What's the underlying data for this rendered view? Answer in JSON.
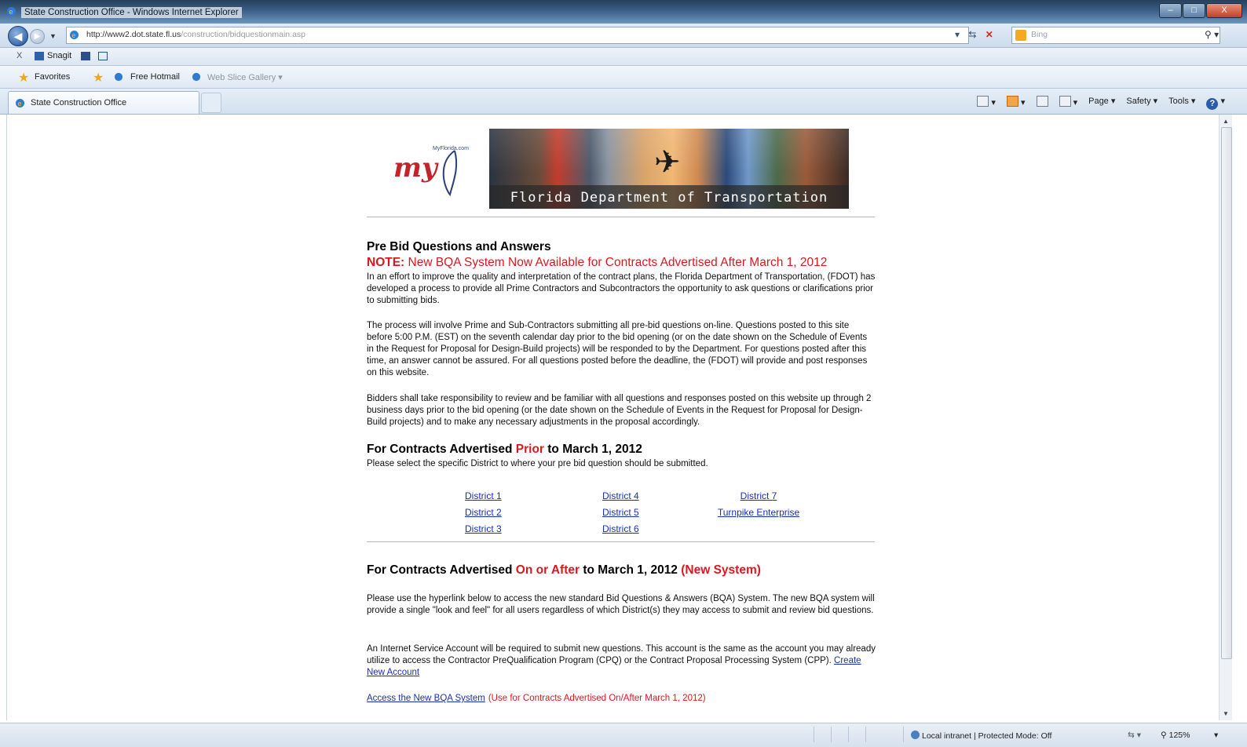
{
  "window": {
    "title": "State Construction Office - Windows Internet Explorer",
    "controls": {
      "minimize": "–",
      "maximize": "□",
      "close": "X"
    }
  },
  "address_bar": {
    "url_host": "http://www2.dot.state.fl.us",
    "url_path": "/construction/bidquestionmain.asp",
    "search_placeholder": "Bing"
  },
  "links_bar": {
    "close": "X",
    "snagit": "Snagit"
  },
  "favorites_bar": {
    "favorites": "Favorites",
    "free_hotmail": "Free Hotmail",
    "web_slice_gallery": "Web Slice Gallery ▾"
  },
  "tab": {
    "title": "State Construction Office"
  },
  "command_bar": {
    "page": "Page ▾",
    "safety": "Safety ▾",
    "tools": "Tools ▾",
    "help": "?"
  },
  "banner": {
    "logo_text": "my",
    "logo_small": "MyFlorida.com",
    "photo_caption": "Florida Department of Transportation"
  },
  "page": {
    "heading": "Pre Bid Questions and Answers",
    "note_label": "NOTE:",
    "note_text": "New BQA System Now Available for Contracts Advertised After March 1, 2012",
    "para1": "In an effort to improve the quality and interpretation of the contract plans, the Florida Department of Transportation, (FDOT) has developed a process to provide all Prime Contractors and Subcontractors the opportunity to ask questions or clarifications prior to submitting bids.",
    "para2": "The process will involve Prime and Sub-Contractors submitting all pre-bid questions on-line. Questions posted to this site before 5:00 P.M. (EST) on the seventh calendar day prior to the bid opening (or on the date shown on the Schedule of Events in the Request for Proposal for Design-Build projects) will be responded to by the Department. For questions posted after this time, an answer cannot be assured. For all questions posted before the deadline, the (FDOT) will provide and post responses on this website.",
    "para3": "Bidders shall take responsibility to review and be familiar with all questions and responses posted on this website up through 2 business days prior to the bid opening (or the date shown on the Schedule of Events in the Request for Proposal for Design-Build projects) and to make any necessary adjustments in the proposal accordingly.",
    "prior_heading_a": "For Contracts Advertised ",
    "prior_heading_red": "Prior",
    "prior_heading_b": " to March 1, 2012",
    "prior_sub": "Please select the specific District to where your pre bid question should be submitted.",
    "districts": {
      "d1": "District 1",
      "d2": "District 2",
      "d3": "District 3",
      "d4": "District 4",
      "d5": "District 5",
      "d6": "District 6",
      "d7": "District 7",
      "turnpike": "Turnpike Enterprise"
    },
    "after_heading_a": "For Contracts Advertised ",
    "after_heading_red": "On or After",
    "after_heading_b": " to March 1, 2012 ",
    "after_heading_new": "(New System)",
    "para4": "Please use the hyperlink below to access the new standard Bid Questions & Answers (BQA) System. The new BQA system will provide a single \"look and feel\" for all users regardless of which District(s) they may access to submit and review bid questions.",
    "para5": "An Internet Service Account will be required to submit new questions. This account is the same as the account you may already utilize to access the Contractor PreQualification Program (CPQ) or the Contract Proposal Processing System (CPP).",
    "create_account": "Create New Account",
    "access_link": "Access the New BQA System",
    "access_note": "(Use for Contracts Advertised On/After March 1, 2012)"
  },
  "status_bar": {
    "zone": "Local intranet | Protected Mode: Off",
    "zoom": "125%"
  }
}
